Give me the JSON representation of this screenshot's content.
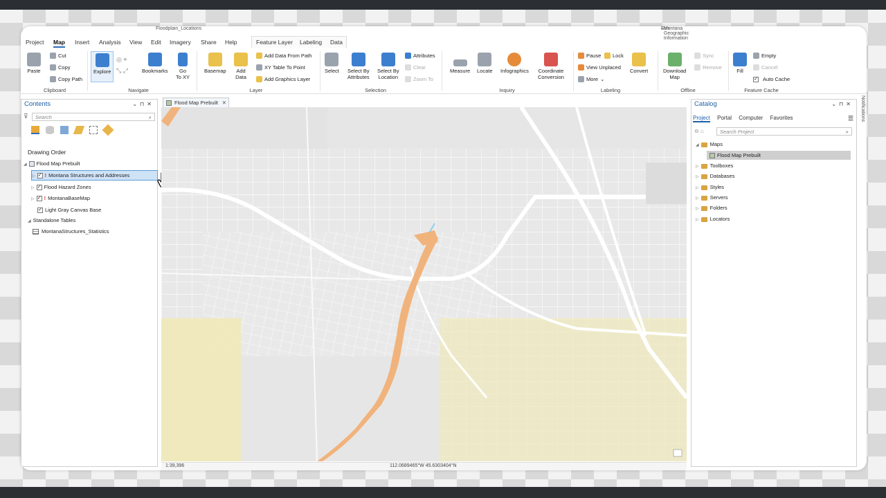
{
  "window": {
    "title": "Floodplain_Locations",
    "user": "Esri",
    "org": "Montana Geographic Information"
  },
  "tabs": [
    {
      "label": "Project"
    },
    {
      "label": "Map"
    },
    {
      "label": "Insert"
    },
    {
      "label": "Analysis"
    },
    {
      "label": "View"
    },
    {
      "label": "Edit"
    },
    {
      "label": "Imagery"
    },
    {
      "label": "Share"
    },
    {
      "label": "Help"
    },
    {
      "label": "Feature Layer"
    },
    {
      "label": "Labeling"
    },
    {
      "label": "Data"
    }
  ],
  "ribbon": {
    "clipboard": {
      "paste": "Paste",
      "cut": "Cut",
      "copy": "Copy",
      "copy_path": "Copy Path",
      "group": "Clipboard"
    },
    "navigate": {
      "explore": "Explore",
      "bookmarks": "Bookmarks",
      "goto": "Go",
      "goto2": "To XY",
      "group": "Navigate"
    },
    "layer": {
      "basemap": "Basemap",
      "add_data": "Add",
      "add_data2": "Data",
      "add_from_path": "Add Data From Path",
      "xy_table": "XY Table To Point",
      "graphics": "Add Graphics Layer",
      "group": "Layer"
    },
    "selection": {
      "select": "Select",
      "by_attr": "Select By",
      "by_attr2": "Attributes",
      "by_loc": "Select By",
      "by_loc2": "Location",
      "attributes": "Attributes",
      "clear": "Clear",
      "zoom_to": "Zoom To",
      "group": "Selection"
    },
    "inquiry": {
      "measure": "Measure",
      "locate": "Locate",
      "infographics": "Infographics",
      "coord": "Coordinate",
      "coord2": "Conversion",
      "group": "Inquiry"
    },
    "labeling": {
      "pause": "Pause",
      "lock": "Lock",
      "view_unplaced": "View Unplaced",
      "more": "More",
      "convert": "Convert",
      "group": "Labeling"
    },
    "offline": {
      "download": "Download",
      "download2": "Map",
      "sync": "Sync",
      "remove": "Remove",
      "group": "Offline"
    },
    "cache": {
      "fill": "Fill",
      "empty": "Empty",
      "cancel": "Cancel",
      "auto": "Auto Cache",
      "group": "Feature Cache"
    }
  },
  "contents": {
    "title": "Contents",
    "search_placeholder": "Search",
    "drawing_order": "Drawing Order",
    "map_name": "Flood Map Prebuilt",
    "layers": [
      {
        "name": "Montana Structures and Addresses",
        "warn": "!"
      },
      {
        "name": "Flood Hazard Zones",
        "warn": ""
      },
      {
        "name": "MontanaBaseMap",
        "warn": "!"
      },
      {
        "name": "Light Gray Canvas Base",
        "warn": ""
      }
    ],
    "standalone": "Standalone Tables",
    "table": "MontanaStructures_Statistics"
  },
  "map": {
    "tab": "Flood Map Prebuilt",
    "scale": "1:39,396",
    "coords": "112.0689465°W 45.6303404°N"
  },
  "catalog": {
    "title": "Catalog",
    "tabs": [
      "Project",
      "Portal",
      "Computer",
      "Favorites"
    ],
    "search_placeholder": "Search Project",
    "maps": "Maps",
    "map_item": "Flood Map Prebuilt",
    "items": [
      "Toolboxes",
      "Databases",
      "Styles",
      "Servers",
      "Folders",
      "Locators"
    ]
  },
  "notifications": "Notifications"
}
